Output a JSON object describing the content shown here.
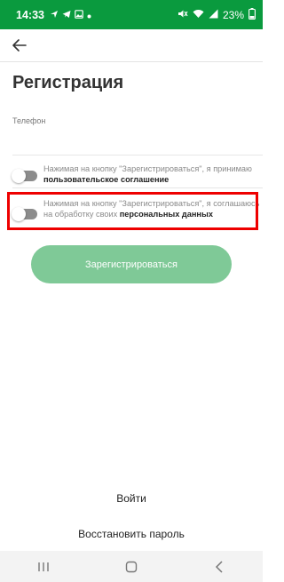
{
  "status": {
    "time": "14:33",
    "battery": "23%"
  },
  "header": {
    "title": "Регистрация"
  },
  "form": {
    "phone_label": "Телефон"
  },
  "consents": [
    {
      "text": "Нажимая на кнопку \"Зарегистрироваться\", я принимаю ",
      "link": "пользовательское соглашение",
      "checked": false
    },
    {
      "text": "Нажимая на кнопку \"Зарегистрироваться\", я соглашаюсь на обработку своих ",
      "link": "персональных данных",
      "checked": false
    }
  ],
  "actions": {
    "register": "Зарегистрироваться",
    "login": "Войти",
    "restore": "Восстановить пароль"
  },
  "colors": {
    "status_bar": "#0a9a3e",
    "register_button": "#7fc997",
    "highlight": "#ee0000"
  }
}
